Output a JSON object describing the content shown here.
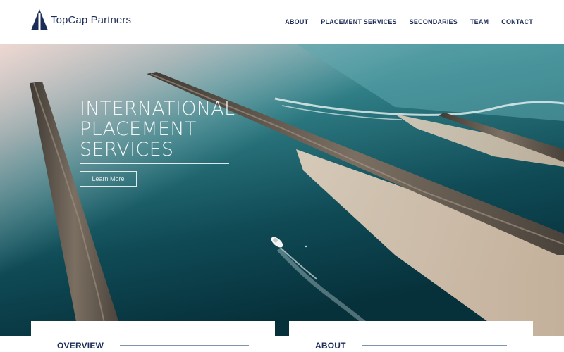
{
  "header": {
    "brand": "TopCap Partners",
    "logo_icon": "triangle-logo-icon",
    "brand_color": "#1b2c57",
    "nav": [
      {
        "label": "ABOUT"
      },
      {
        "label": "PLACEMENT SERVICES"
      },
      {
        "label": "SECONDARIES"
      },
      {
        "label": "TEAM"
      },
      {
        "label": "CONTACT"
      }
    ]
  },
  "hero": {
    "title_line1": "INTERNATIONAL",
    "title_line2": "PLACEMENT",
    "title_line3": "SERVICES",
    "button_label": "Learn More",
    "image_subject": "aerial-sea-jetties-boat"
  },
  "cards": {
    "overview_title": "OVERVIEW",
    "about_title": "ABOUT"
  }
}
